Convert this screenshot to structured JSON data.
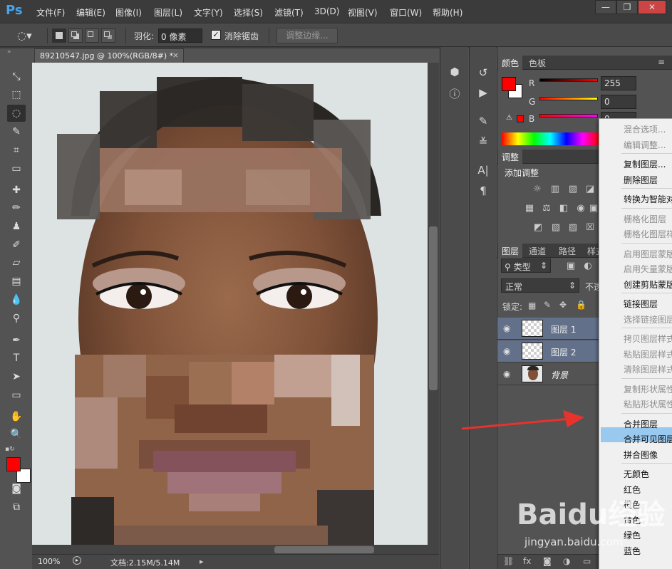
{
  "app": {
    "logo": "Ps",
    "menus": [
      "文件(F)",
      "编辑(E)",
      "图像(I)",
      "图层(L)",
      "文字(Y)",
      "选择(S)",
      "滤镜(T)",
      "3D(D)",
      "视图(V)",
      "窗口(W)",
      "帮助(H)"
    ],
    "window_buttons": [
      "—",
      "❐",
      "✕"
    ]
  },
  "options": {
    "feather_label": "羽化:",
    "feather_value": "0 像素",
    "antialias_label": "消除锯齿",
    "antialias_checked": true,
    "refine_edge_label": "调整边缘..."
  },
  "document": {
    "tab_title": "89210547.jpg @ 100%(RGB/8#) *",
    "tab_close": "×",
    "zoom": "100%",
    "doc_size": "文档:2.15M/5.14M"
  },
  "color_panel": {
    "tabs": [
      "颜色",
      "色板"
    ],
    "r_label": "R",
    "g_label": "G",
    "b_label": "B",
    "r": "255",
    "g": "0",
    "b": "0",
    "foreground": "#ff0000",
    "background": "#ffffff"
  },
  "adjust_panel": {
    "tab": "调整",
    "title": "添加调整"
  },
  "layers_panel": {
    "tabs": [
      "图层",
      "通道",
      "路径",
      "样式"
    ],
    "filter": "类型",
    "blend_mode": "正常",
    "opacity_label": "不透明度",
    "lock_label": "锁定:",
    "layers": [
      {
        "name": "图层 1",
        "selected": true
      },
      {
        "name": "图层 2",
        "selected": true
      },
      {
        "name": "背景",
        "selected": false
      }
    ]
  },
  "context_menu": {
    "items": [
      {
        "label": "混合选项...",
        "disabled": true
      },
      {
        "label": "编辑调整...",
        "disabled": true
      },
      {
        "sep": true
      },
      {
        "label": "复制图层...",
        "disabled": false
      },
      {
        "label": "删除图层",
        "disabled": false
      },
      {
        "sep": true
      },
      {
        "label": "转换为智能对象",
        "disabled": false
      },
      {
        "sep": true
      },
      {
        "label": "栅格化图层",
        "disabled": true
      },
      {
        "label": "栅格化图层样式",
        "disabled": true
      },
      {
        "sep": true
      },
      {
        "label": "启用图层蒙版",
        "disabled": true
      },
      {
        "label": "启用矢量蒙版",
        "disabled": true
      },
      {
        "label": "创建剪贴蒙版",
        "disabled": false
      },
      {
        "sep": true
      },
      {
        "label": "链接图层",
        "disabled": false
      },
      {
        "label": "选择链接图层",
        "disabled": true
      },
      {
        "sep": true
      },
      {
        "label": "拷贝图层样式",
        "disabled": true
      },
      {
        "label": "粘贴图层样式",
        "disabled": true
      },
      {
        "label": "清除图层样式",
        "disabled": true
      },
      {
        "sep": true
      },
      {
        "label": "复制形状属性",
        "disabled": true
      },
      {
        "label": "粘贴形状属性",
        "disabled": true
      },
      {
        "sep": true
      },
      {
        "label": "合并图层",
        "disabled": false,
        "highlighted": true
      },
      {
        "label": "合并可见图层",
        "disabled": false
      },
      {
        "label": "拼合图像",
        "disabled": false
      },
      {
        "sep": true
      },
      {
        "label": "无颜色",
        "disabled": false
      },
      {
        "label": "红色",
        "disabled": false
      },
      {
        "label": "橙色",
        "disabled": false
      },
      {
        "label": "黄色",
        "disabled": false
      },
      {
        "label": "绿色",
        "disabled": false
      },
      {
        "label": "蓝色",
        "disabled": false
      }
    ]
  },
  "watermark": {
    "text": "Baidu经验",
    "sub": "jingyan.baidu.com"
  },
  "annotation": {
    "color": "#e8322c"
  }
}
